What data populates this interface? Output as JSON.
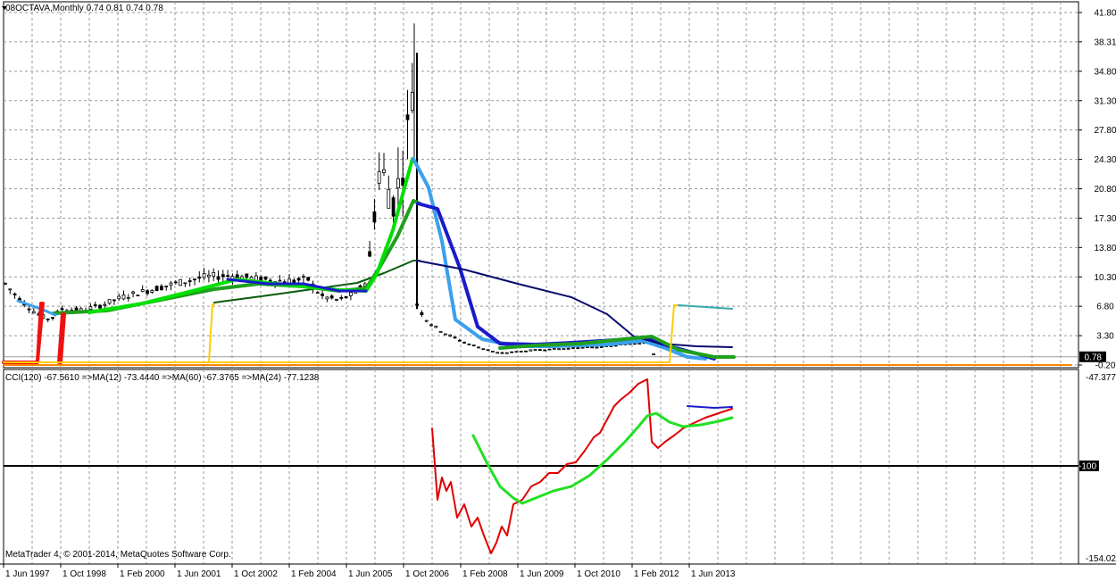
{
  "app": {
    "footer": "MetaTrader 4, © 2001-2014, MetaQuotes Software Corp."
  },
  "main_chart": {
    "header": "08OCTAVA,Monthly  0.74 0.81 0.74 0.78",
    "price_axis_ticks": [
      "41.80",
      "38.31",
      "34.80",
      "31.30",
      "27.80",
      "24.30",
      "20.80",
      "17.30",
      "13.80",
      "10.30",
      "6.80",
      "3.30",
      "-0.20"
    ],
    "current_price": "0.78"
  },
  "indicator": {
    "header": "CCI(120) -67.5610  =>MA(12) -73.4440  =>MA(60) -67.3765  =>MA(24) -77.1238",
    "axis_top": "-47.3775",
    "axis_bottom": "-154.023",
    "level_label": "-100"
  },
  "time_axis": [
    "1 Jun 1997",
    "1 Oct 1998",
    "1 Feb 2000",
    "1 Jun 2001",
    "1 Oct 2002",
    "1 Feb 2004",
    "1 Jun 2005",
    "1 Oct 2006",
    "1 Feb 2008",
    "1 Jun 2009",
    "1 Oct 2010",
    "1 Feb 2012",
    "1 Jun 2013"
  ],
  "colors": {
    "candle": "#000000",
    "grid": "#9a9a9a",
    "ma_fast": "#00e000",
    "ma_mid": "#1fa01f",
    "ma_slow": "#0a5a0a",
    "ma_light_blue": "#3aa0ee",
    "ma_blue": "#1a1acc",
    "ma_navy": "#0a0a70",
    "cci": "#e00000",
    "cci_ma": "#22e022",
    "signal_red": "#ee1111",
    "signal_yellow": "#ffcc00",
    "signal_orange": "#ff8800",
    "cyan_line": "#33aaaa"
  }
}
